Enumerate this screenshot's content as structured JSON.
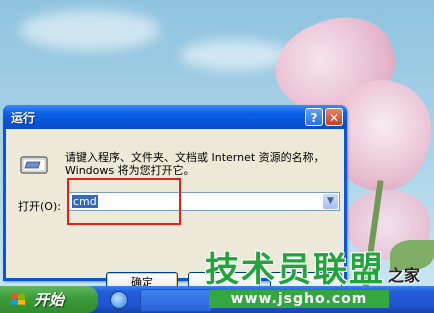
{
  "window": {
    "title": "运行",
    "help_glyph": "?",
    "close_glyph": "✕",
    "description": "请键入程序、文件夹、文档或 Internet 资源的名称，Windows 将为您打开它。",
    "open_label": "打开(O):",
    "command_value": "cmd",
    "buttons": {
      "ok": "确定",
      "cancel": "",
      "browse": ""
    }
  },
  "taskbar": {
    "start_label": "开始"
  },
  "watermark": {
    "brand": "技术员联盟",
    "suffix": "之家",
    "url": "www.jsgho.com"
  },
  "colors": {
    "highlight": "#e0231a",
    "titlebar": "#0a5fe8",
    "start_button": "#3c9c3a"
  },
  "icons": {
    "run_app": "run-dialog-icon",
    "start_logo": "windows-logo-icon",
    "quicklaunch": "ie-icon"
  }
}
